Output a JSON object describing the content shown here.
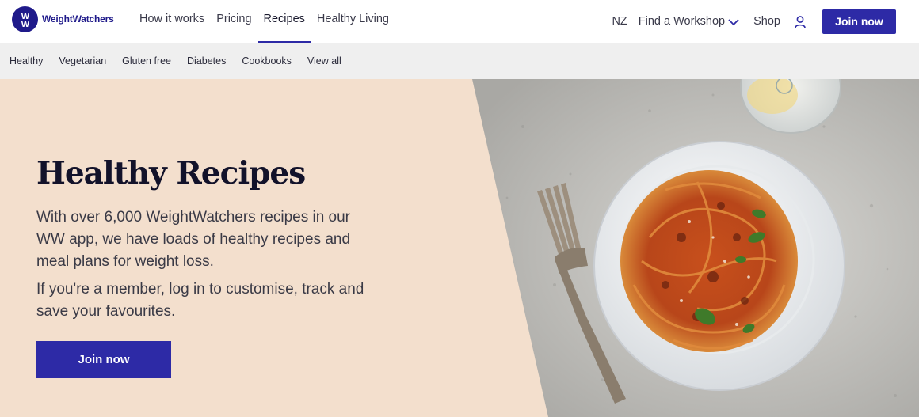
{
  "brand": {
    "name": "WeightWatchers",
    "logo_icon": "ww-logo-icon",
    "color": "#1f1a8a"
  },
  "nav": {
    "primary": [
      {
        "label": "How it works",
        "active": false
      },
      {
        "label": "Pricing",
        "active": false
      },
      {
        "label": "Recipes",
        "active": true
      },
      {
        "label": "Healthy Living",
        "active": false
      }
    ],
    "country": "NZ",
    "workshop_label": "Find a Workshop",
    "workshop_icon": "chevron-down-icon",
    "shop_label": "Shop",
    "user_icon": "user-icon",
    "join_label": "Join now"
  },
  "subnav": {
    "items": [
      "Healthy",
      "Vegetarian",
      "Gluten free",
      "Diabetes",
      "Cookbooks",
      "View all"
    ]
  },
  "hero": {
    "title": "Healthy Recipes",
    "paragraph1": "With over 6,000 WeightWatchers recipes in our WW app, we have loads of healthy recipes and meal plans for weight loss.",
    "paragraph2": "If you're a member, log in to customise, track and save your favourites.",
    "cta_label": "Join now",
    "background_color": "#f3dfcd",
    "image": "spaghetti-bolognese-plate-image"
  },
  "colors": {
    "accent": "#2d2aa6",
    "subnav_bg": "#efefef"
  }
}
